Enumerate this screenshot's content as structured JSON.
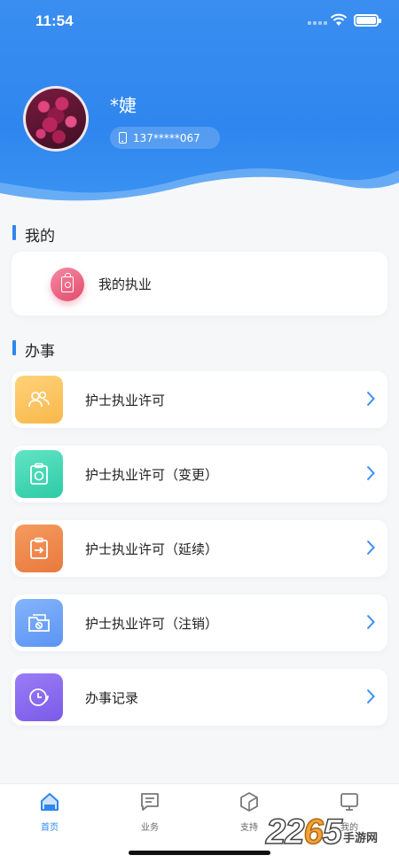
{
  "status_bar": {
    "time": "11:54"
  },
  "profile": {
    "name": "*婕",
    "phone": "137*****067"
  },
  "sections": {
    "mine_title": "我的",
    "tasks_title": "办事"
  },
  "mine": {
    "label": "我的执业",
    "icon": "badge-icon"
  },
  "tasks": [
    {
      "label": "护士执业许可",
      "icon": "users-icon",
      "color": "#f8b84b"
    },
    {
      "label": "护士执业许可（变更）",
      "icon": "clipboard-cycle-icon",
      "color": "#2dcba6"
    },
    {
      "label": "护士执业许可（延续）",
      "icon": "clipboard-arrow-icon",
      "color": "#e9793e"
    },
    {
      "label": "护士执业许可（注销）",
      "icon": "folder-cancel-icon",
      "color": "#5b94f3"
    },
    {
      "label": "办事记录",
      "icon": "clock-icon",
      "color": "#7c5be8"
    }
  ],
  "tabbar": {
    "home": "首页",
    "business": "业务",
    "support": "支持",
    "mine": "我的",
    "active": "home",
    "accent": "#2f86ee"
  },
  "watermark": {
    "number": "2265",
    "site": "手游网"
  }
}
